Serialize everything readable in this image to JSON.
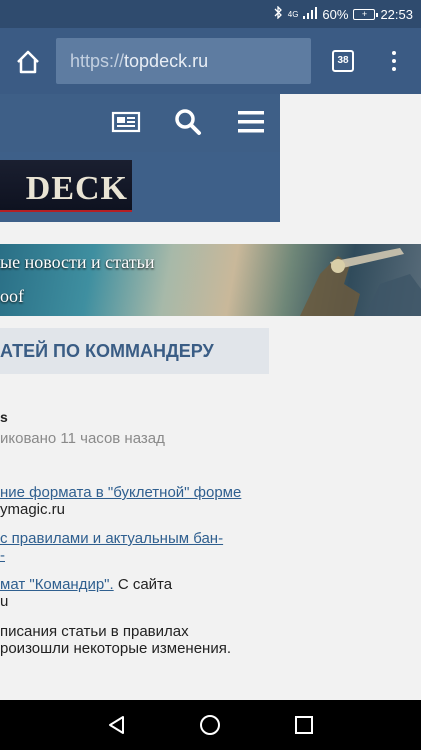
{
  "status_bar": {
    "network": "4G",
    "battery_percent": "60%",
    "time": "22:53"
  },
  "browser": {
    "url_scheme": "https://",
    "url_host": "topdeck.ru",
    "tab_count": "38"
  },
  "site": {
    "logo_text": "DECK"
  },
  "banner": {
    "line1": "ые новости и статьи",
    "line2": "oof"
  },
  "section": {
    "title": "АТЕЙ ПО КОММАНДЕРУ"
  },
  "article": {
    "title": "s",
    "meta": "иковано 11 часов назад",
    "lines": {
      "l1": "ние формата в \"буклетной\" форме",
      "l2": "ymagic.ru",
      "l3": "с правилами и актуальным бан-",
      "l4": "-",
      "l5_link": "мат \"Командир\".",
      "l5_rest": " С сайта",
      "l6": "u",
      "l7": "писания статьи в правилах",
      "l8": "роизошли некоторые изменения."
    }
  },
  "colors": {
    "status_bar": "#2f4b6e",
    "browser_bar": "#3b5b84",
    "site_nav": "#3e5f87",
    "link": "#2f5f8f",
    "section_text": "#3a5d85"
  }
}
